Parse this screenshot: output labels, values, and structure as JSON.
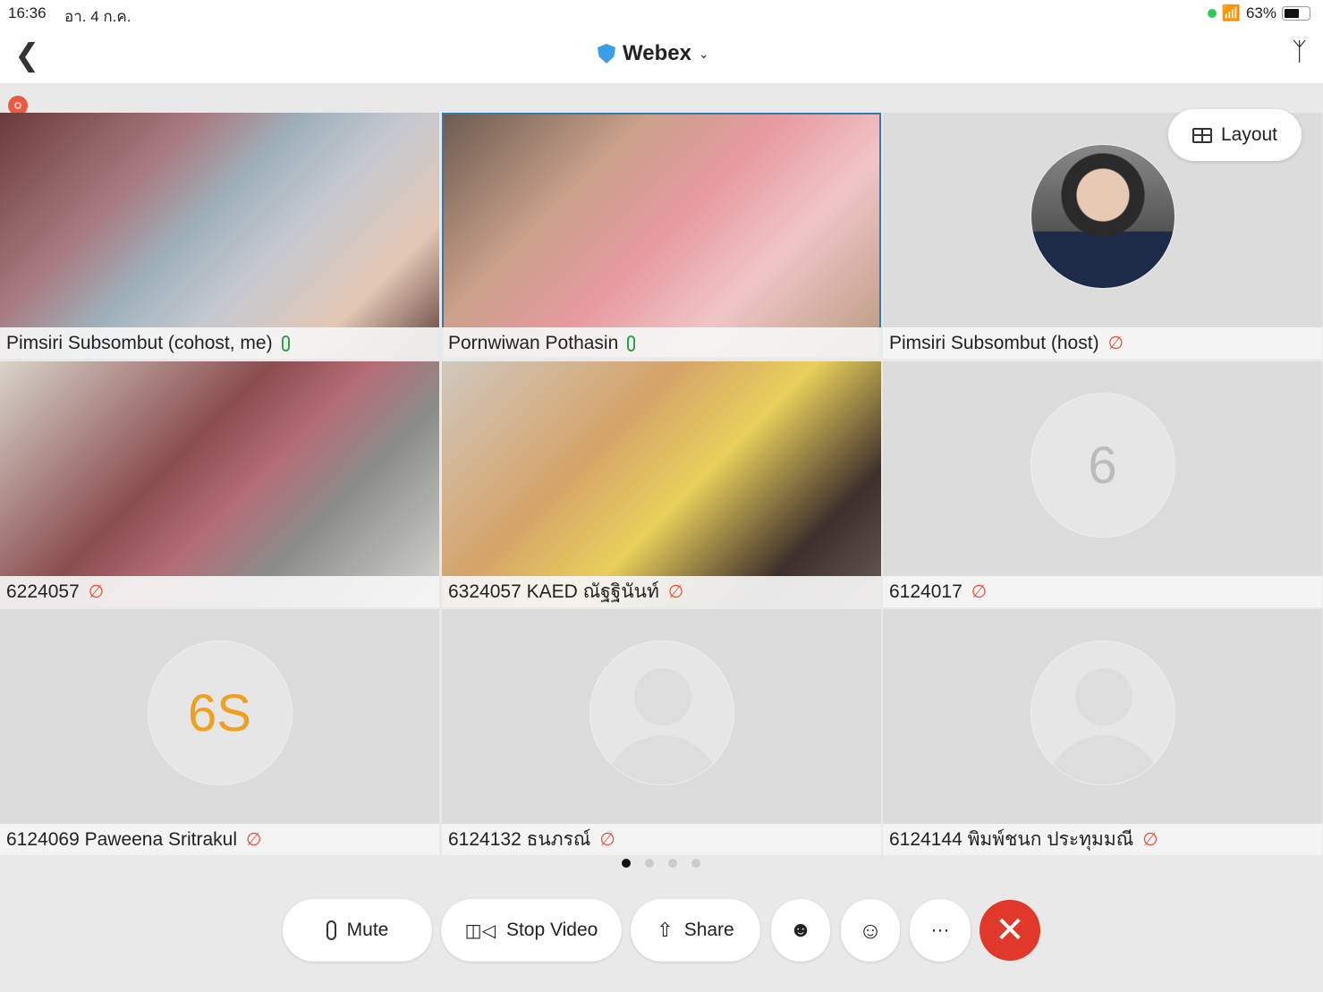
{
  "status": {
    "time": "16:36",
    "date": "อา. 4 ก.ค.",
    "battery": "63%",
    "battery_level": 0.63
  },
  "header": {
    "title": "Webex",
    "brand_color": "#3a9ee6"
  },
  "layout_label": "Layout",
  "tiles": [
    {
      "name": "Pimsiri Subsombut (cohost, me)",
      "mic": "on",
      "type": "video"
    },
    {
      "name": "Pornwiwan Pothasin",
      "mic": "on",
      "type": "video",
      "active": true
    },
    {
      "name": "Pimsiri Subsombut (host)",
      "mic": "muted",
      "type": "photo"
    },
    {
      "name": "6224057",
      "mic": "muted",
      "type": "video"
    },
    {
      "name": "6324057 KAED ณัฐฐินันท์",
      "mic": "muted",
      "type": "video"
    },
    {
      "name": "6124017",
      "mic": "muted",
      "type": "initials",
      "initials": "6"
    },
    {
      "name": "6124069 Paweena Sritrakul",
      "mic": "muted",
      "type": "initials",
      "initials": "6S"
    },
    {
      "name": "6124132 ธนภรณ์",
      "mic": "muted",
      "type": "placeholder"
    },
    {
      "name": "6124144 พิมพ์ชนก ประทุมมณี",
      "mic": "muted",
      "type": "placeholder"
    }
  ],
  "pages": {
    "count": 4,
    "current": 1
  },
  "controls": {
    "mute": "Mute",
    "stop_video": "Stop Video",
    "share": "Share",
    "end_color": "#e0382a"
  }
}
